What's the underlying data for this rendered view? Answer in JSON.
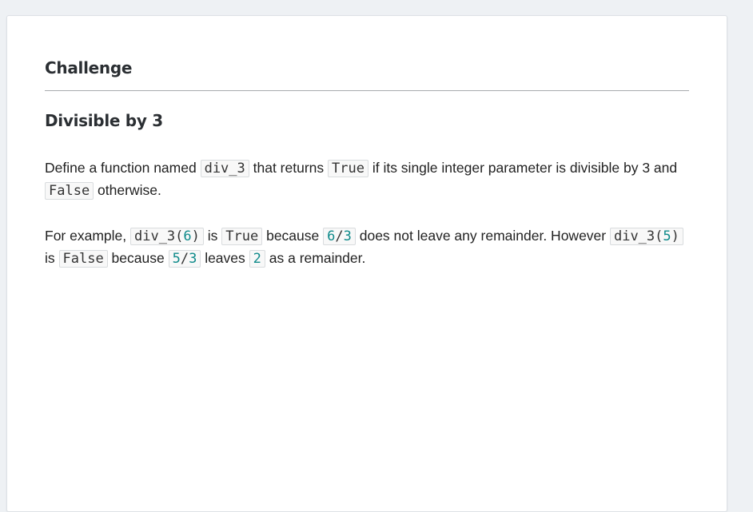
{
  "header": {
    "title": "Challenge"
  },
  "problem": {
    "title": "Divisible by 3",
    "paragraph1": {
      "t1": "Define a function named ",
      "c1": "div_3",
      "t2": " that returns ",
      "c2": "True",
      "t3": " if its single integer parameter is divisible by 3 and ",
      "c3": "False",
      "t4": " otherwise."
    },
    "paragraph2": {
      "t1": "For example, ",
      "c1_pre": "div_3(",
      "c1_num": "6",
      "c1_post": ")",
      "t2": " is ",
      "c2": "True",
      "t3": " because ",
      "c3_a": "6",
      "c3_op": "/",
      "c3_b": "3",
      "t4": " does not leave any remainder. However ",
      "c4_pre": "div_3(",
      "c4_num": "5",
      "c4_post": ")",
      "t5": " is ",
      "c5": "False",
      "t6": " because ",
      "c6_a": "5",
      "c6_op": "/",
      "c6_b": "3",
      "t7": " leaves ",
      "c7": "2",
      "t8": " as a remainder."
    }
  },
  "colors": {
    "page_background": "#eef1f4",
    "card_background": "#ffffff",
    "number_literal": "#0e8a8a"
  }
}
